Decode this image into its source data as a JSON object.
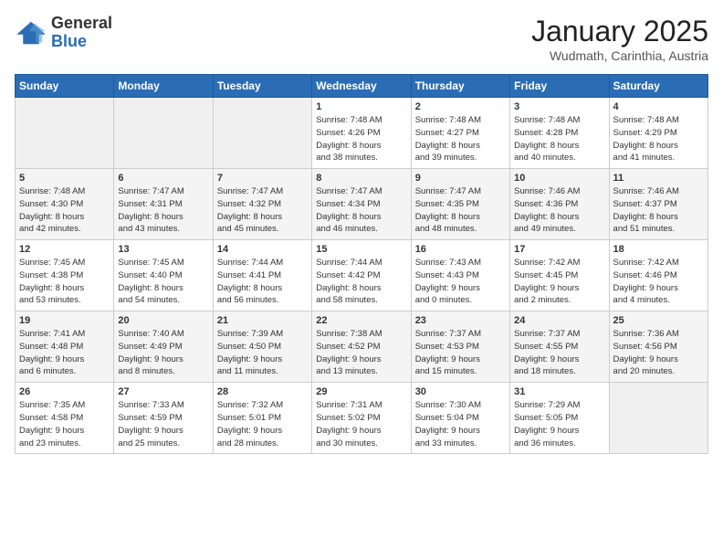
{
  "header": {
    "logo_general": "General",
    "logo_blue": "Blue",
    "month_title": "January 2025",
    "location": "Wudmath, Carinthia, Austria"
  },
  "days_of_week": [
    "Sunday",
    "Monday",
    "Tuesday",
    "Wednesday",
    "Thursday",
    "Friday",
    "Saturday"
  ],
  "weeks": [
    [
      {
        "day": "",
        "info": ""
      },
      {
        "day": "",
        "info": ""
      },
      {
        "day": "",
        "info": ""
      },
      {
        "day": "1",
        "info": "Sunrise: 7:48 AM\nSunset: 4:26 PM\nDaylight: 8 hours\nand 38 minutes."
      },
      {
        "day": "2",
        "info": "Sunrise: 7:48 AM\nSunset: 4:27 PM\nDaylight: 8 hours\nand 39 minutes."
      },
      {
        "day": "3",
        "info": "Sunrise: 7:48 AM\nSunset: 4:28 PM\nDaylight: 8 hours\nand 40 minutes."
      },
      {
        "day": "4",
        "info": "Sunrise: 7:48 AM\nSunset: 4:29 PM\nDaylight: 8 hours\nand 41 minutes."
      }
    ],
    [
      {
        "day": "5",
        "info": "Sunrise: 7:48 AM\nSunset: 4:30 PM\nDaylight: 8 hours\nand 42 minutes."
      },
      {
        "day": "6",
        "info": "Sunrise: 7:47 AM\nSunset: 4:31 PM\nDaylight: 8 hours\nand 43 minutes."
      },
      {
        "day": "7",
        "info": "Sunrise: 7:47 AM\nSunset: 4:32 PM\nDaylight: 8 hours\nand 45 minutes."
      },
      {
        "day": "8",
        "info": "Sunrise: 7:47 AM\nSunset: 4:34 PM\nDaylight: 8 hours\nand 46 minutes."
      },
      {
        "day": "9",
        "info": "Sunrise: 7:47 AM\nSunset: 4:35 PM\nDaylight: 8 hours\nand 48 minutes."
      },
      {
        "day": "10",
        "info": "Sunrise: 7:46 AM\nSunset: 4:36 PM\nDaylight: 8 hours\nand 49 minutes."
      },
      {
        "day": "11",
        "info": "Sunrise: 7:46 AM\nSunset: 4:37 PM\nDaylight: 8 hours\nand 51 minutes."
      }
    ],
    [
      {
        "day": "12",
        "info": "Sunrise: 7:45 AM\nSunset: 4:38 PM\nDaylight: 8 hours\nand 53 minutes."
      },
      {
        "day": "13",
        "info": "Sunrise: 7:45 AM\nSunset: 4:40 PM\nDaylight: 8 hours\nand 54 minutes."
      },
      {
        "day": "14",
        "info": "Sunrise: 7:44 AM\nSunset: 4:41 PM\nDaylight: 8 hours\nand 56 minutes."
      },
      {
        "day": "15",
        "info": "Sunrise: 7:44 AM\nSunset: 4:42 PM\nDaylight: 8 hours\nand 58 minutes."
      },
      {
        "day": "16",
        "info": "Sunrise: 7:43 AM\nSunset: 4:43 PM\nDaylight: 9 hours\nand 0 minutes."
      },
      {
        "day": "17",
        "info": "Sunrise: 7:42 AM\nSunset: 4:45 PM\nDaylight: 9 hours\nand 2 minutes."
      },
      {
        "day": "18",
        "info": "Sunrise: 7:42 AM\nSunset: 4:46 PM\nDaylight: 9 hours\nand 4 minutes."
      }
    ],
    [
      {
        "day": "19",
        "info": "Sunrise: 7:41 AM\nSunset: 4:48 PM\nDaylight: 9 hours\nand 6 minutes."
      },
      {
        "day": "20",
        "info": "Sunrise: 7:40 AM\nSunset: 4:49 PM\nDaylight: 9 hours\nand 8 minutes."
      },
      {
        "day": "21",
        "info": "Sunrise: 7:39 AM\nSunset: 4:50 PM\nDaylight: 9 hours\nand 11 minutes."
      },
      {
        "day": "22",
        "info": "Sunrise: 7:38 AM\nSunset: 4:52 PM\nDaylight: 9 hours\nand 13 minutes."
      },
      {
        "day": "23",
        "info": "Sunrise: 7:37 AM\nSunset: 4:53 PM\nDaylight: 9 hours\nand 15 minutes."
      },
      {
        "day": "24",
        "info": "Sunrise: 7:37 AM\nSunset: 4:55 PM\nDaylight: 9 hours\nand 18 minutes."
      },
      {
        "day": "25",
        "info": "Sunrise: 7:36 AM\nSunset: 4:56 PM\nDaylight: 9 hours\nand 20 minutes."
      }
    ],
    [
      {
        "day": "26",
        "info": "Sunrise: 7:35 AM\nSunset: 4:58 PM\nDaylight: 9 hours\nand 23 minutes."
      },
      {
        "day": "27",
        "info": "Sunrise: 7:33 AM\nSunset: 4:59 PM\nDaylight: 9 hours\nand 25 minutes."
      },
      {
        "day": "28",
        "info": "Sunrise: 7:32 AM\nSunset: 5:01 PM\nDaylight: 9 hours\nand 28 minutes."
      },
      {
        "day": "29",
        "info": "Sunrise: 7:31 AM\nSunset: 5:02 PM\nDaylight: 9 hours\nand 30 minutes."
      },
      {
        "day": "30",
        "info": "Sunrise: 7:30 AM\nSunset: 5:04 PM\nDaylight: 9 hours\nand 33 minutes."
      },
      {
        "day": "31",
        "info": "Sunrise: 7:29 AM\nSunset: 5:05 PM\nDaylight: 9 hours\nand 36 minutes."
      },
      {
        "day": "",
        "info": ""
      }
    ]
  ]
}
